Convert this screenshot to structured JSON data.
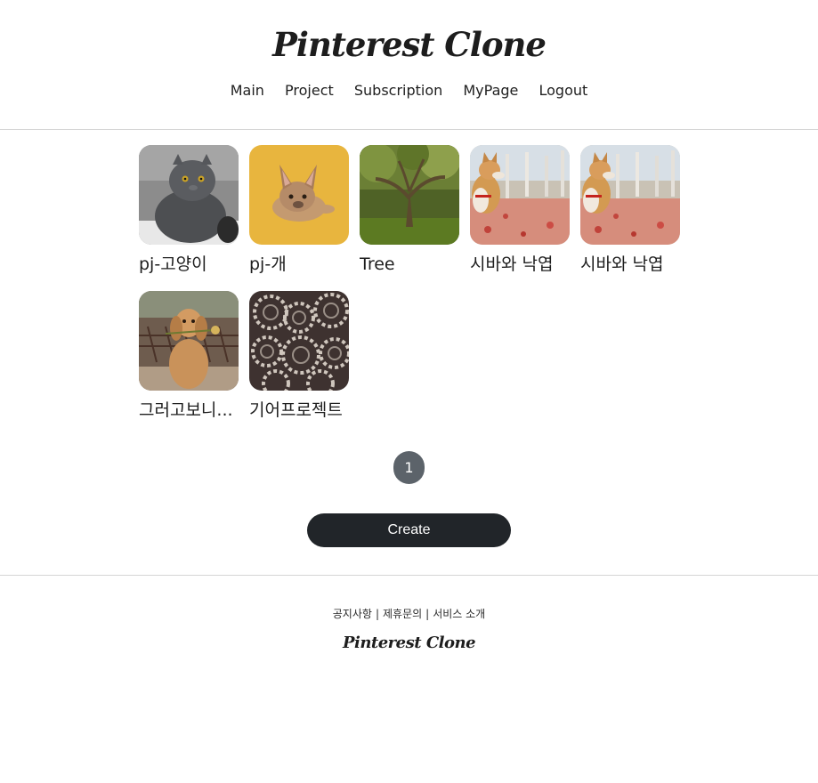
{
  "header": {
    "logo": "Pinterest Clone",
    "nav": [
      "Main",
      "Project",
      "Subscription",
      "MyPage",
      "Logout"
    ]
  },
  "projects": [
    {
      "title": "pj-고양이",
      "image": "gray-cat-photo"
    },
    {
      "title": "pj-개",
      "image": "french-bulldog-photo"
    },
    {
      "title": "Tree",
      "image": "tree-forest-photo"
    },
    {
      "title": "시바와 낙엽",
      "image": "shiba-leaves-photo"
    },
    {
      "title": "시바와 낙엽",
      "image": "shiba-leaves-photo"
    },
    {
      "title": "그러고보니...",
      "image": "spaniel-rose-photo"
    },
    {
      "title": "기어프로젝트",
      "image": "gears-photo"
    }
  ],
  "pagination": {
    "current": "1"
  },
  "create_label": "Create",
  "footer": {
    "links": [
      "공지사항",
      "제휴문의",
      "서비스 소개"
    ],
    "logo": "Pinterest Clone"
  }
}
